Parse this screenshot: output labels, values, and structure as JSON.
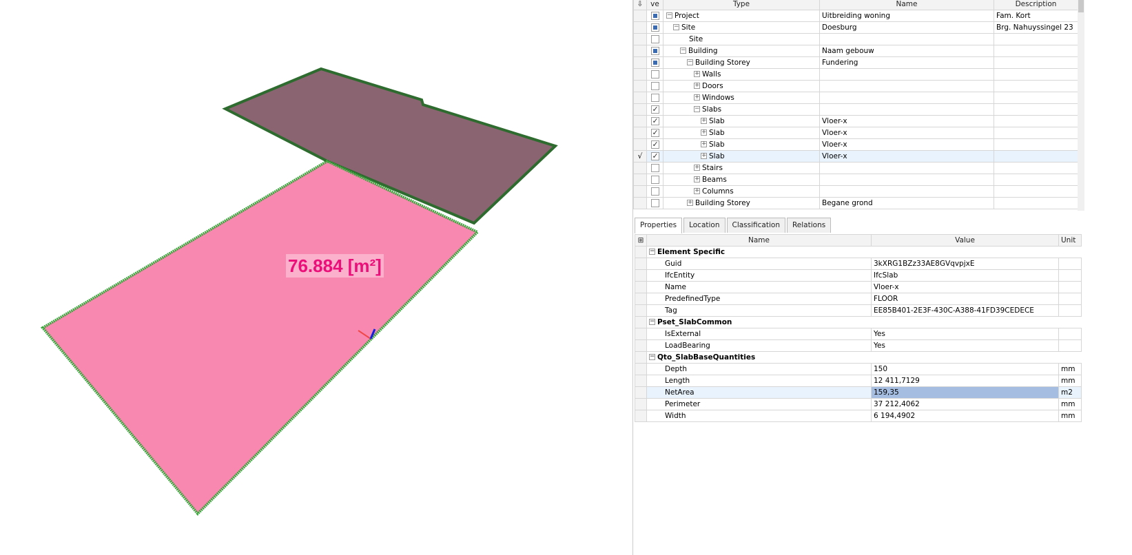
{
  "viewport": {
    "area_label": "76.884 [m²]",
    "colors": {
      "selected_slab": "#f888b0",
      "other_slab": "#8a6470",
      "edge": "#2e8b2e",
      "label_text": "#ec0f7a"
    }
  },
  "tree": {
    "headers": {
      "ve": "ve",
      "type": "Type",
      "name": "Name",
      "description": "Description"
    },
    "rows": [
      {
        "type": "Project",
        "name": "Uitbreiding woning",
        "description": "Fam. Kort",
        "check": "part",
        "toggle": "−",
        "level": 0
      },
      {
        "type": "Site",
        "name": "Doesburg",
        "description": "Brg. Nahuyssingel 23",
        "check": "part",
        "toggle": "−",
        "level": 1
      },
      {
        "type": "Site",
        "name": "",
        "description": "",
        "check": "none",
        "toggle": "",
        "level": 2
      },
      {
        "type": "Building",
        "name": "Naam gebouw",
        "description": "",
        "check": "part",
        "toggle": "−",
        "level": 2
      },
      {
        "type": "Building Storey",
        "name": "Fundering",
        "description": "",
        "check": "part",
        "toggle": "−",
        "level": 3
      },
      {
        "type": "Walls",
        "name": "",
        "description": "",
        "check": "none",
        "toggle": "+",
        "level": 4
      },
      {
        "type": "Doors",
        "name": "",
        "description": "",
        "check": "none",
        "toggle": "+",
        "level": 4
      },
      {
        "type": "Windows",
        "name": "",
        "description": "",
        "check": "none",
        "toggle": "+",
        "level": 4
      },
      {
        "type": "Slabs",
        "name": "",
        "description": "",
        "check": "chk",
        "toggle": "−",
        "level": 4
      },
      {
        "type": "Slab",
        "name": "Vloer-x",
        "description": "",
        "check": "chk",
        "toggle": "+",
        "level": 5
      },
      {
        "type": "Slab",
        "name": "Vloer-x",
        "description": "",
        "check": "chk",
        "toggle": "+",
        "level": 5
      },
      {
        "type": "Slab",
        "name": "Vloer-x",
        "description": "",
        "check": "chk",
        "toggle": "+",
        "level": 5
      },
      {
        "type": "Slab",
        "name": "Vloer-x",
        "description": "",
        "check": "chk",
        "toggle": "+",
        "level": 5,
        "selected": true,
        "marker": "√"
      },
      {
        "type": "Stairs",
        "name": "",
        "description": "",
        "check": "none",
        "toggle": "+",
        "level": 4
      },
      {
        "type": "Beams",
        "name": "",
        "description": "",
        "check": "none",
        "toggle": "+",
        "level": 4
      },
      {
        "type": "Columns",
        "name": "",
        "description": "",
        "check": "none",
        "toggle": "+",
        "level": 4
      },
      {
        "type": "Building Storey",
        "name": "Begane grond",
        "description": "",
        "check": "none",
        "toggle": "+",
        "level": 3
      }
    ]
  },
  "tabs": [
    "Properties",
    "Location",
    "Classification",
    "Relations"
  ],
  "properties": {
    "headers": {
      "name": "Name",
      "value": "Value",
      "unit": "Unit"
    },
    "groups": [
      {
        "name": "Element Specific",
        "items": [
          {
            "name": "Guid",
            "value": "3kXRG1BZz33AE8GVqvpjxE",
            "unit": ""
          },
          {
            "name": "IfcEntity",
            "value": "IfcSlab",
            "unit": ""
          },
          {
            "name": "Name",
            "value": "Vloer-x",
            "unit": ""
          },
          {
            "name": "PredefinedType",
            "value": "FLOOR",
            "unit": ""
          },
          {
            "name": "Tag",
            "value": "EE85B401-2E3F-430C-A388-41FD39CEDECE",
            "unit": ""
          }
        ]
      },
      {
        "name": "Pset_SlabCommon",
        "items": [
          {
            "name": "IsExternal",
            "value": "Yes",
            "unit": ""
          },
          {
            "name": "LoadBearing",
            "value": "Yes",
            "unit": ""
          }
        ]
      },
      {
        "name": "Qto_SlabBaseQuantities",
        "items": [
          {
            "name": "Depth",
            "value": "150",
            "unit": "mm"
          },
          {
            "name": "Length",
            "value": "12 411,7129",
            "unit": "mm"
          },
          {
            "name": "NetArea",
            "value": "159,35",
            "unit": "m2",
            "selected": true
          },
          {
            "name": "Perimeter",
            "value": "37 212,4062",
            "unit": "mm"
          },
          {
            "name": "Width",
            "value": "6 194,4902",
            "unit": "mm"
          }
        ]
      }
    ]
  }
}
